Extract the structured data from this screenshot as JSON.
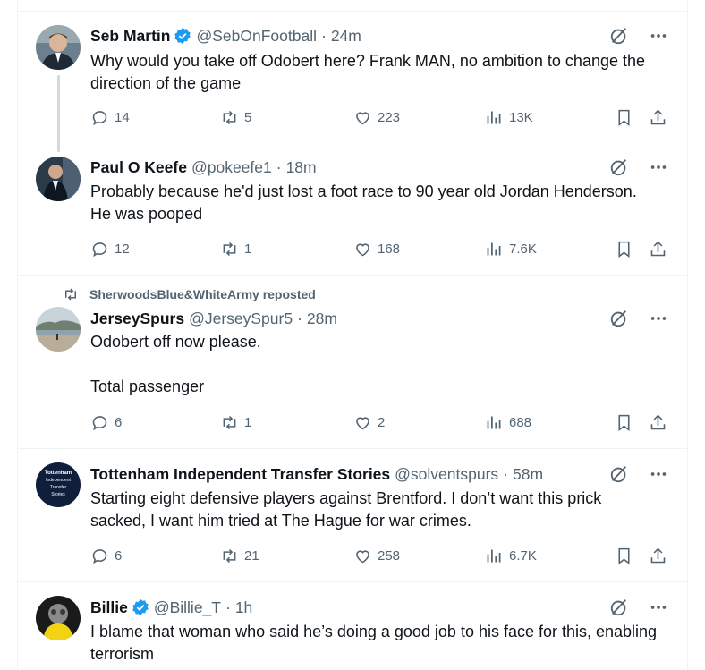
{
  "tweets": [
    {
      "name": "Seb Martin",
      "verified": true,
      "handle": "@SebOnFootball",
      "separator": "·",
      "time": "24m",
      "text": "Why would you take off Odobert here? Frank MAN, no ambition to change the direction of the game",
      "replies": "14",
      "reposts": "5",
      "likes": "223",
      "views": "13K"
    },
    {
      "name": "Paul O Keefe",
      "verified": false,
      "handle": "@pokeefe1",
      "separator": "·",
      "time": "18m",
      "text": "Probably because he'd just lost a foot race to 90 year old Jordan Henderson. He was pooped",
      "replies": "12",
      "reposts": "1",
      "likes": "168",
      "views": "7.6K"
    },
    {
      "reposted_by": "SherwoodsBlue&WhiteArmy reposted",
      "name": "JerseySpurs",
      "verified": false,
      "handle": "@JerseySpur5",
      "separator": "·",
      "time": "28m",
      "text": "Odobert off now please.\n\nTotal passenger",
      "replies": "6",
      "reposts": "1",
      "likes": "2",
      "views": "688"
    },
    {
      "name": "Tottenham Independent Transfer Stories",
      "verified": false,
      "handle": "@solventspurs",
      "separator": "·",
      "time": "58m",
      "avatar_text": "Tottenham Independent Transfer Stories",
      "text": "Starting eight defensive players against Brentford. I don’t want this prick sacked, I want him tried at The Hague for war crimes.",
      "replies": "6",
      "reposts": "21",
      "likes": "258",
      "views": "6.7K"
    },
    {
      "name": "Billie",
      "verified": true,
      "handle": "@Billie_T",
      "separator": "·",
      "time": "1h",
      "text": "I blame that woman who said he’s doing a good job to his face for this, enabling terrorism"
    }
  ],
  "colors": {
    "text": "#0f1419",
    "secondary": "#536471",
    "verified": "#1d9bf0",
    "border": "#eff3f4",
    "thread_line": "#cfd9de"
  },
  "icons": {
    "verified": "verified-badge-icon",
    "grok": "grok-icon",
    "more": "more-icon",
    "reply": "reply-icon",
    "repost": "repost-icon",
    "like": "like-icon",
    "views": "views-icon",
    "bookmark": "bookmark-icon",
    "share": "share-icon"
  }
}
